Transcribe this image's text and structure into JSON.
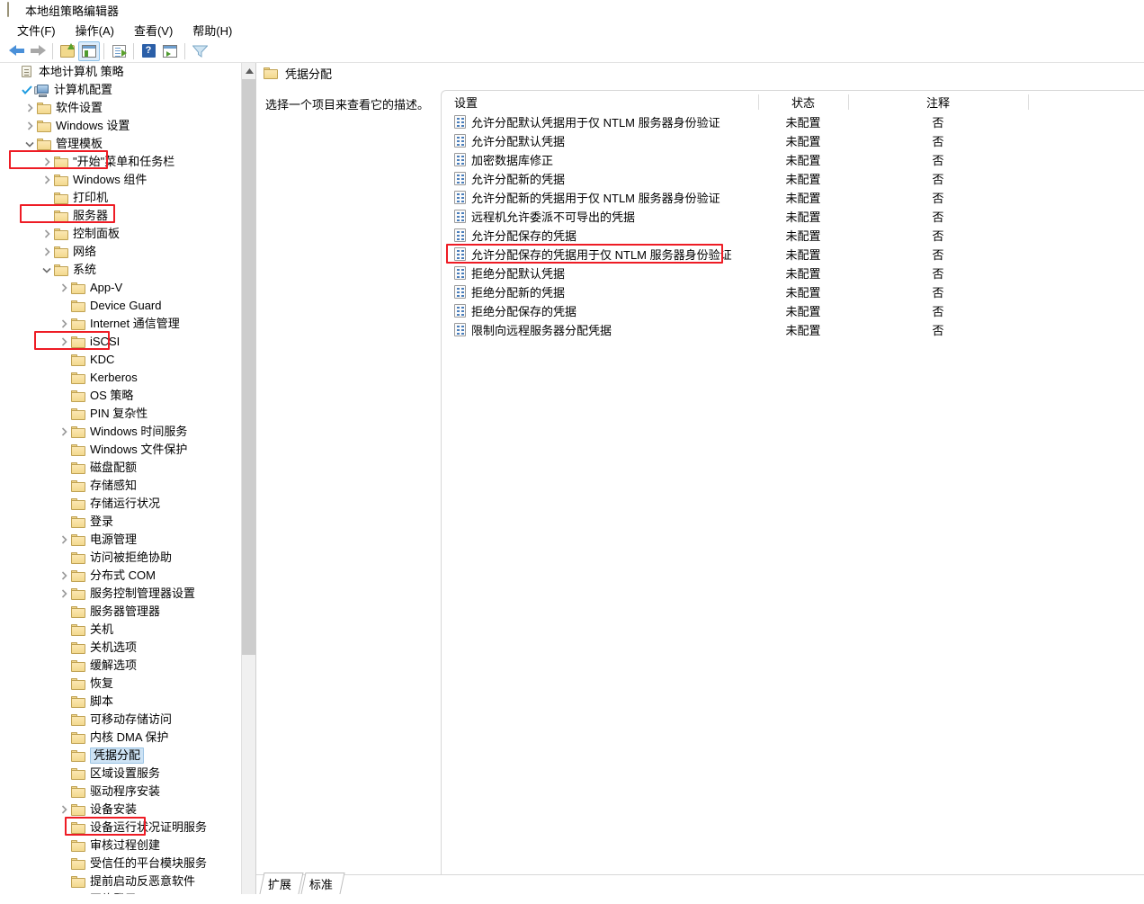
{
  "window": {
    "title": "本地组策略编辑器",
    "icon": "document-icon"
  },
  "menu": {
    "items": [
      {
        "label": "文件(F)",
        "name": "menu-file"
      },
      {
        "label": "操作(A)",
        "name": "menu-action"
      },
      {
        "label": "查看(V)",
        "name": "menu-view"
      },
      {
        "label": "帮助(H)",
        "name": "menu-help"
      }
    ]
  },
  "toolbar": {
    "buttons": [
      {
        "name": "back-button",
        "icon": "arrow-left-icon"
      },
      {
        "name": "forward-button",
        "icon": "arrow-right-icon"
      },
      {
        "name": "up-one-level-button",
        "icon": "folder-up-icon"
      },
      {
        "name": "show-hide-tree-button",
        "icon": "window-pane-icon"
      },
      {
        "name": "export-list-button",
        "icon": "export-list-icon"
      },
      {
        "name": "help-button",
        "icon": "question-mark-icon"
      },
      {
        "name": "properties-button",
        "icon": "window-run-icon"
      },
      {
        "name": "filter-button",
        "icon": "funnel-filter-icon"
      }
    ]
  },
  "tree": {
    "root": "本地计算机 策略",
    "items": [
      {
        "label": "计算机配置",
        "indent": 1,
        "twisty": "none",
        "icon": "computer-icon",
        "checked": true,
        "highlight": true
      },
      {
        "label": "软件设置",
        "indent": 2,
        "twisty": "collapsed",
        "icon": "folder-icon"
      },
      {
        "label": "Windows 设置",
        "indent": 2,
        "twisty": "collapsed",
        "icon": "folder-icon"
      },
      {
        "label": "管理模板",
        "indent": 2,
        "twisty": "expanded",
        "icon": "folder-icon",
        "highlight": true
      },
      {
        "label": "\"开始\"菜单和任务栏",
        "indent": 3,
        "twisty": "collapsed",
        "icon": "folder-icon"
      },
      {
        "label": "Windows 组件",
        "indent": 3,
        "twisty": "collapsed",
        "icon": "folder-icon"
      },
      {
        "label": "打印机",
        "indent": 3,
        "twisty": "none",
        "icon": "folder-icon"
      },
      {
        "label": "服务器",
        "indent": 3,
        "twisty": "none",
        "icon": "folder-icon"
      },
      {
        "label": "控制面板",
        "indent": 3,
        "twisty": "collapsed",
        "icon": "folder-icon"
      },
      {
        "label": "网络",
        "indent": 3,
        "twisty": "collapsed",
        "icon": "folder-icon"
      },
      {
        "label": "系统",
        "indent": 3,
        "twisty": "expanded",
        "icon": "folder-icon",
        "highlight": true
      },
      {
        "label": "App-V",
        "indent": 4,
        "twisty": "collapsed",
        "icon": "folder-icon"
      },
      {
        "label": "Device Guard",
        "indent": 4,
        "twisty": "none",
        "icon": "folder-icon"
      },
      {
        "label": "Internet 通信管理",
        "indent": 4,
        "twisty": "collapsed",
        "icon": "folder-icon"
      },
      {
        "label": "iSCSI",
        "indent": 4,
        "twisty": "collapsed",
        "icon": "folder-icon"
      },
      {
        "label": "KDC",
        "indent": 4,
        "twisty": "none",
        "icon": "folder-icon"
      },
      {
        "label": "Kerberos",
        "indent": 4,
        "twisty": "none",
        "icon": "folder-icon"
      },
      {
        "label": "OS 策略",
        "indent": 4,
        "twisty": "none",
        "icon": "folder-icon"
      },
      {
        "label": "PIN 复杂性",
        "indent": 4,
        "twisty": "none",
        "icon": "folder-icon"
      },
      {
        "label": "Windows 时间服务",
        "indent": 4,
        "twisty": "collapsed",
        "icon": "folder-icon"
      },
      {
        "label": "Windows 文件保护",
        "indent": 4,
        "twisty": "none",
        "icon": "folder-icon"
      },
      {
        "label": "磁盘配额",
        "indent": 4,
        "twisty": "none",
        "icon": "folder-icon"
      },
      {
        "label": "存储感知",
        "indent": 4,
        "twisty": "none",
        "icon": "folder-icon"
      },
      {
        "label": "存储运行状况",
        "indent": 4,
        "twisty": "none",
        "icon": "folder-icon"
      },
      {
        "label": "登录",
        "indent": 4,
        "twisty": "none",
        "icon": "folder-icon"
      },
      {
        "label": "电源管理",
        "indent": 4,
        "twisty": "collapsed",
        "icon": "folder-icon"
      },
      {
        "label": "访问被拒绝协助",
        "indent": 4,
        "twisty": "none",
        "icon": "folder-icon"
      },
      {
        "label": "分布式 COM",
        "indent": 4,
        "twisty": "collapsed",
        "icon": "folder-icon"
      },
      {
        "label": "服务控制管理器设置",
        "indent": 4,
        "twisty": "collapsed",
        "icon": "folder-icon"
      },
      {
        "label": "服务器管理器",
        "indent": 4,
        "twisty": "none",
        "icon": "folder-icon"
      },
      {
        "label": "关机",
        "indent": 4,
        "twisty": "none",
        "icon": "folder-icon"
      },
      {
        "label": "关机选项",
        "indent": 4,
        "twisty": "none",
        "icon": "folder-icon"
      },
      {
        "label": "缓解选项",
        "indent": 4,
        "twisty": "none",
        "icon": "folder-icon"
      },
      {
        "label": "恢复",
        "indent": 4,
        "twisty": "none",
        "icon": "folder-icon"
      },
      {
        "label": "脚本",
        "indent": 4,
        "twisty": "none",
        "icon": "folder-icon"
      },
      {
        "label": "可移动存储访问",
        "indent": 4,
        "twisty": "none",
        "icon": "folder-icon"
      },
      {
        "label": "内核 DMA 保护",
        "indent": 4,
        "twisty": "none",
        "icon": "folder-icon"
      },
      {
        "label": "凭据分配",
        "indent": 4,
        "twisty": "none",
        "icon": "folder-icon",
        "selected": true,
        "highlight": true
      },
      {
        "label": "区域设置服务",
        "indent": 4,
        "twisty": "none",
        "icon": "folder-icon"
      },
      {
        "label": "驱动程序安装",
        "indent": 4,
        "twisty": "none",
        "icon": "folder-icon"
      },
      {
        "label": "设备安装",
        "indent": 4,
        "twisty": "collapsed",
        "icon": "folder-icon"
      },
      {
        "label": "设备运行状况证明服务",
        "indent": 4,
        "twisty": "none",
        "icon": "folder-icon"
      },
      {
        "label": "审核过程创建",
        "indent": 4,
        "twisty": "none",
        "icon": "folder-icon"
      },
      {
        "label": "受信任的平台模块服务",
        "indent": 4,
        "twisty": "none",
        "icon": "folder-icon"
      },
      {
        "label": "提前启动反恶意软件",
        "indent": 4,
        "twisty": "none",
        "icon": "folder-icon"
      },
      {
        "label": "网络登录",
        "indent": 4,
        "twisty": "collapsed",
        "icon": "folder-icon"
      }
    ]
  },
  "detail": {
    "header_title": "凭据分配",
    "description": "选择一个项目来查看它的描述。",
    "columns": {
      "setting": "设置",
      "status": "状态",
      "comment": "注释"
    },
    "rows": [
      {
        "setting": "允许分配默认凭据用于仅 NTLM 服务器身份验证",
        "status": "未配置",
        "comment": "否"
      },
      {
        "setting": "允许分配默认凭据",
        "status": "未配置",
        "comment": "否"
      },
      {
        "setting": "加密数据库修正",
        "status": "未配置",
        "comment": "否"
      },
      {
        "setting": "允许分配新的凭据",
        "status": "未配置",
        "comment": "否"
      },
      {
        "setting": "允许分配新的凭据用于仅 NTLM 服务器身份验证",
        "status": "未配置",
        "comment": "否"
      },
      {
        "setting": "远程机允许委派不可导出的凭据",
        "status": "未配置",
        "comment": "否"
      },
      {
        "setting": "允许分配保存的凭据",
        "status": "未配置",
        "comment": "否"
      },
      {
        "setting": "允许分配保存的凭据用于仅 NTLM 服务器身份验证",
        "status": "未配置",
        "comment": "否",
        "highlight": true
      },
      {
        "setting": "拒绝分配默认凭据",
        "status": "未配置",
        "comment": "否"
      },
      {
        "setting": "拒绝分配新的凭据",
        "status": "未配置",
        "comment": "否"
      },
      {
        "setting": "拒绝分配保存的凭据",
        "status": "未配置",
        "comment": "否"
      },
      {
        "setting": "限制向远程服务器分配凭据",
        "status": "未配置",
        "comment": "否"
      }
    ],
    "tabs": [
      {
        "label": "扩展",
        "active": false
      },
      {
        "label": "标准",
        "active": true
      }
    ]
  },
  "colors": {
    "annotation": "#ee1c25",
    "selection": "#cde3f5",
    "folder": "#f3d98e"
  }
}
